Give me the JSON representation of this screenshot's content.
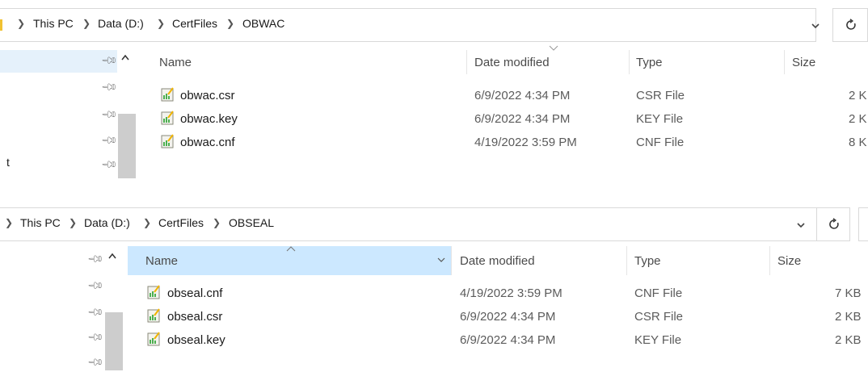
{
  "top": {
    "breadcrumb": [
      "This PC",
      "Data (D:)",
      "CertFiles",
      "OBWAC"
    ],
    "columns": {
      "name": "Name",
      "date": "Date modified",
      "type": "Type",
      "size": "Size"
    },
    "files": [
      {
        "name": "obwac.csr",
        "date": "6/9/2022 4:34 PM",
        "type": "CSR File",
        "size": "2 K"
      },
      {
        "name": "obwac.key",
        "date": "6/9/2022 4:34 PM",
        "type": "KEY File",
        "size": "2 K"
      },
      {
        "name": "obwac.cnf",
        "date": "4/19/2022 3:59 PM",
        "type": "CNF File",
        "size": "8 K"
      }
    ],
    "nav_partial_label": "t"
  },
  "bottom": {
    "breadcrumb": [
      "This PC",
      "Data (D:)",
      "CertFiles",
      "OBSEAL"
    ],
    "columns": {
      "name": "Name",
      "date": "Date modified",
      "type": "Type",
      "size": "Size"
    },
    "files": [
      {
        "name": "obseal.cnf",
        "date": "4/19/2022 3:59 PM",
        "type": "CNF File",
        "size": "7 KB"
      },
      {
        "name": "obseal.csr",
        "date": "6/9/2022 4:34 PM",
        "type": "CSR File",
        "size": "2 KB"
      },
      {
        "name": "obseal.key",
        "date": "6/9/2022 4:34 PM",
        "type": "KEY File",
        "size": "2 KB"
      }
    ]
  },
  "colors": {
    "selected_header": "#cce8ff",
    "nav_selected": "#e5f1fb",
    "scroll_thumb": "#cdcdcd"
  },
  "icons": {
    "pin": "pin-icon",
    "file": "certificate-file-icon",
    "refresh": "refresh-icon",
    "dropdown": "chevron-down-icon"
  }
}
